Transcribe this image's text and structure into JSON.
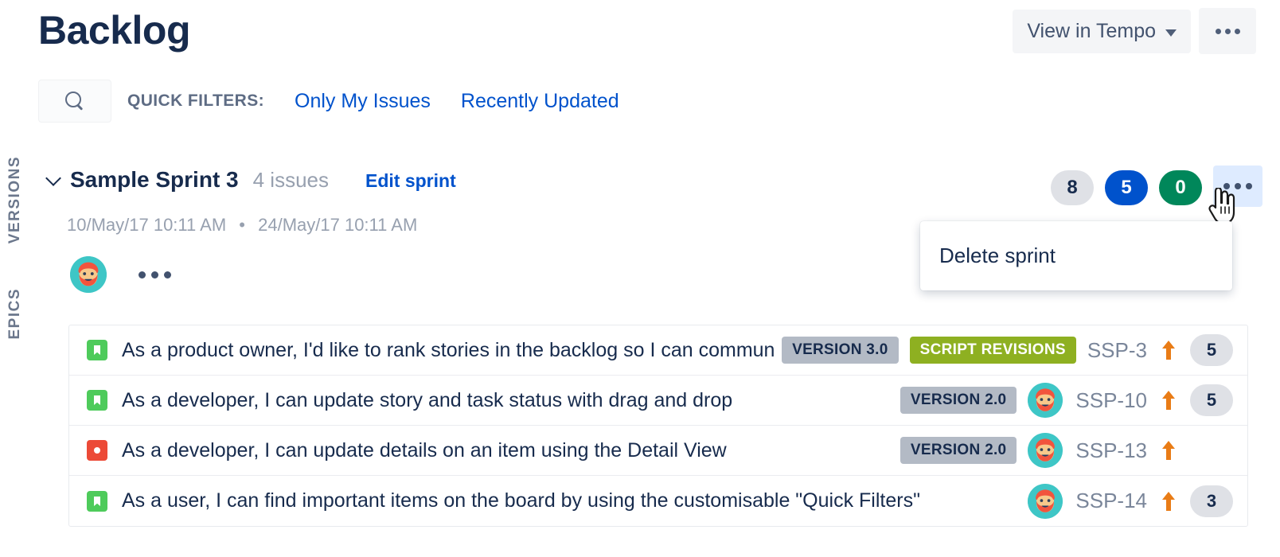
{
  "header": {
    "title": "Backlog",
    "view_in_tempo_label": "View in Tempo",
    "more_icon": "ellipsis-icon"
  },
  "filter_bar": {
    "search_placeholder": "",
    "search_value": "",
    "quick_filters_label": "QUICK FILTERS:",
    "filters": [
      {
        "label": "Only My Issues"
      },
      {
        "label": "Recently Updated"
      }
    ]
  },
  "side_rails": [
    {
      "label": "VERSIONS"
    },
    {
      "label": "EPICS"
    }
  ],
  "sprint": {
    "name": "Sample Sprint 3",
    "issue_count_label": "4 issues",
    "edit_label": "Edit sprint",
    "start_date": "10/May/17 10:11 AM",
    "date_separator": "•",
    "end_date": "24/May/17 10:11 AM",
    "stats": [
      {
        "value": "8",
        "color": "#dfe1e6",
        "style": "grey"
      },
      {
        "value": "5",
        "color": "#0052cc",
        "style": "blue"
      },
      {
        "value": "0",
        "color": "#00875a",
        "style": "green"
      }
    ]
  },
  "dropdown": {
    "items": [
      {
        "label": "Delete sprint"
      }
    ]
  },
  "issues": [
    {
      "type": "story",
      "summary": "As a product owner, I'd like to rank stories in the backlog so I can communicate the priority",
      "lozenges": [
        {
          "label": "VERSION 3.0",
          "kind": "version"
        },
        {
          "label": "SCRIPT REVISIONS",
          "kind": "epic"
        }
      ],
      "has_avatar": false,
      "key": "SSP-3",
      "priority": "high",
      "points": "5"
    },
    {
      "type": "story",
      "summary": "As a developer, I can update story and task status with drag and drop",
      "lozenges": [
        {
          "label": "VERSION 2.0",
          "kind": "version"
        }
      ],
      "has_avatar": true,
      "key": "SSP-10",
      "priority": "high",
      "points": "5"
    },
    {
      "type": "bug",
      "summary": "As a developer, I can update details on an item using the Detail View",
      "lozenges": [
        {
          "label": "VERSION 2.0",
          "kind": "version"
        }
      ],
      "has_avatar": true,
      "key": "SSP-13",
      "priority": "high",
      "points": ""
    },
    {
      "type": "story",
      "summary": "As a user, I can find important items on the board by using the customisable \"Quick Filters\"",
      "lozenges": [],
      "has_avatar": true,
      "key": "SSP-14",
      "priority": "high",
      "points": "3"
    }
  ],
  "colors": {
    "brand_blue": "#0052cc",
    "title_navy": "#172b4d",
    "green_story": "#4ecb5b",
    "red_bug": "#ec4a37",
    "epic_green": "#8eb021",
    "version_grey": "#b3bac5",
    "priority_orange": "#e97c16",
    "avatar_teal": "#3ec6c6"
  }
}
